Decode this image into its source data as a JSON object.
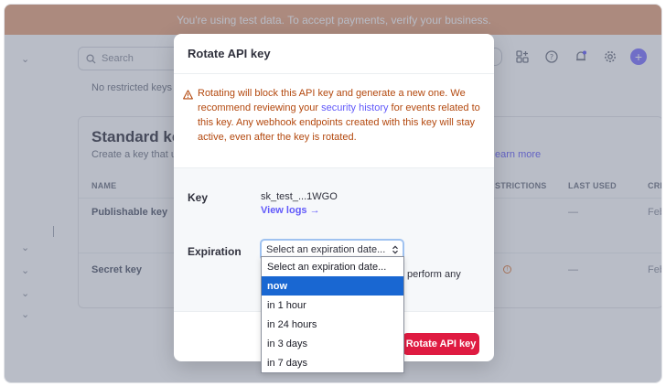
{
  "banner": {
    "text": "You're using test data. To accept payments, verify your business."
  },
  "background": {
    "search_placeholder": "Search",
    "restricted_empty": "No restricted keys",
    "standard": {
      "title": "Standard keys",
      "subtitle": "Create a key that u",
      "learn_more": "earn more",
      "headers": {
        "name": "NAME",
        "restrictions": "STRICTIONS",
        "last_used": "LAST USED",
        "created": "CREA"
      },
      "rows": [
        {
          "name": "Publishable key",
          "last_used": "—",
          "created": "Feb"
        },
        {
          "name": "Secret key",
          "last_used": "—",
          "created": "Feb"
        }
      ]
    }
  },
  "modal": {
    "title": "Rotate API key",
    "warning": {
      "before_link": "Rotating will block this API key and generate a new one. We recommend reviewing your ",
      "link": "security history",
      "after_link": " for events related to this key. Any webhook endpoints created with this key will stay active, even after the key is rotated."
    },
    "key_label": "Key",
    "key_value": "sk_test_...1WGO",
    "view_logs": "View logs →",
    "expiration_label": "Expiration",
    "select_value": "Select an expiration date...",
    "trailing_text": "perform any",
    "rotate_button": "Rotate API key"
  },
  "dropdown": {
    "options": [
      "Select an expiration date...",
      "now",
      "in 1 hour",
      "in 24 hours",
      "in 3 days",
      "in 7 days"
    ],
    "highlighted_index": 1
  },
  "colors": {
    "banner": "#e8a37a",
    "accent": "#625afa",
    "danger": "#df1b41",
    "warning": "#b3480e",
    "highlight": "#1967d2"
  }
}
